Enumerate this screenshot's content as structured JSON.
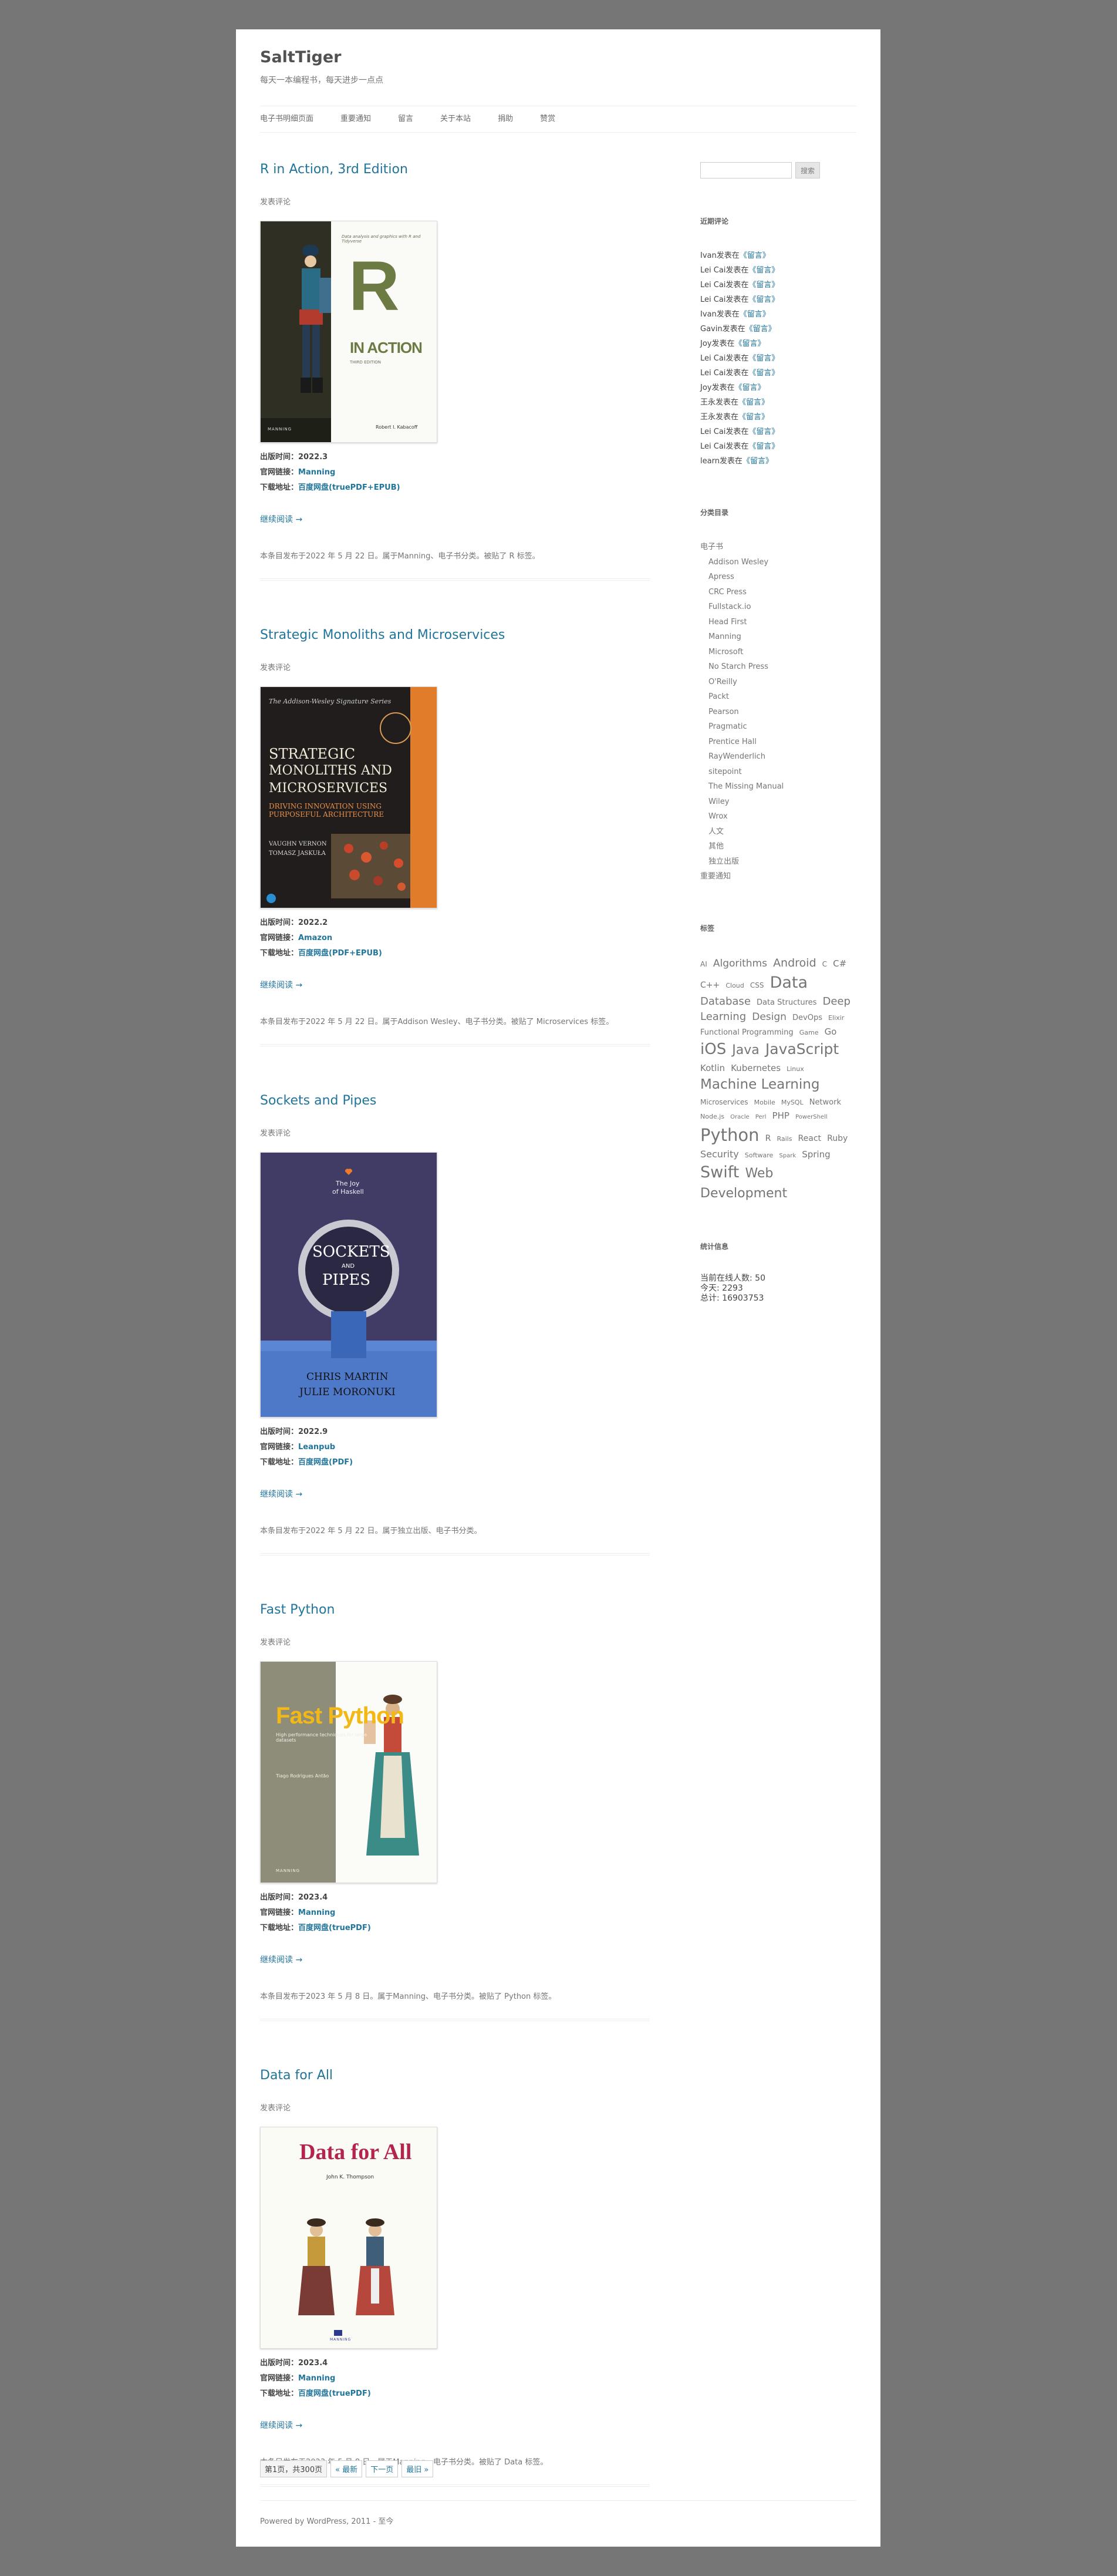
{
  "site": {
    "title": "SaltTiger",
    "description": "每天一本编程书，每天进步一点点"
  },
  "nav": [
    "电子书明细页面",
    "重要通知",
    "留言",
    "关于本站",
    "捐助",
    "赞赏"
  ],
  "posts": [
    {
      "title": "R in Action, 3rd Edition",
      "comments": "发表评论",
      "pub_label": "出版时间：",
      "pub": "2022.3",
      "site_label": "官网链接：",
      "site": "Manning",
      "dl_label": "下载地址：",
      "dl": "百度网盘(truePDF+EPUB)",
      "more": "继续阅读 →",
      "footer": "本条目发布于2022 年 5 月 22 日。属于Manning、电子书分类。被贴了 R 标签。",
      "cover": {
        "top": "Data analysis and graphics with R and Tidyverse",
        "letter": "R",
        "sub": "IN ACTION",
        "ed": "THIRD EDITION",
        "author": "Robert I. Kabacoff",
        "pub": "MANNING"
      }
    },
    {
      "title": "Strategic Monoliths and Microservices",
      "comments": "发表评论",
      "pub_label": "出版时间：",
      "pub": "2022.2",
      "site_label": "官网链接：",
      "site": "Amazon",
      "dl_label": "下载地址：",
      "dl": "百度网盘(PDF+EPUB)",
      "more": "继续阅读 →",
      "footer": "本条目发布于2022 年 5 月 22 日。属于Addison Wesley、电子书分类。被贴了 Microservices 标签。",
      "cover": {
        "top": "The Addison-Wesley Signature Series",
        "t1": "STRATEGIC",
        "t2": "MONOLITHS AND",
        "t3": "MICROSERVICES",
        "sub": "DRIVING INNOVATION USING PURPOSEFUL ARCHITECTURE",
        "a1": "VAUGHN VERNON",
        "a2": "TOMASZ JASKUŁA"
      }
    },
    {
      "title": "Sockets and Pipes",
      "comments": "发表评论",
      "pub_label": "出版时间：",
      "pub": "2022.9",
      "site_label": "官网链接：",
      "site": "Leanpub",
      "dl_label": "下载地址：",
      "dl": "百度网盘(PDF)",
      "more": "继续阅读 →",
      "footer": "本条目发布于2022 年 5 月 22 日。属于独立出版、电子书分类。",
      "cover": {
        "top1": "The Joy",
        "top2": "of Haskell",
        "t1": "SOCKETS",
        "t2": "AND",
        "t3": "PIPES",
        "a1": "CHRIS MARTIN",
        "a2": "JULIE MORONUKI"
      }
    },
    {
      "title": "Fast Python",
      "comments": "发表评论",
      "pub_label": "出版时间：",
      "pub": "2023.4",
      "site_label": "官网链接：",
      "site": "Manning",
      "dl_label": "下载地址：",
      "dl": "百度网盘(truePDF)",
      "more": "继续阅读 →",
      "footer": "本条目发布于2023 年 5 月 8 日。属于Manning、电子书分类。被贴了 Python 标签。",
      "cover": {
        "title": "Fast Python",
        "sub": "High performance techniques for large datasets",
        "author": "Tiago Rodrigues Antão",
        "pub": "MANNING"
      }
    },
    {
      "title": "Data for All",
      "comments": "发表评论",
      "pub_label": "出版时间：",
      "pub": "2023.4",
      "site_label": "官网链接：",
      "site": "Manning",
      "dl_label": "下载地址：",
      "dl": "百度网盘(truePDF)",
      "more": "继续阅读 →",
      "footer": "本条目发布于2023 年 5 月 8 日。属于Manning、电子书分类。被贴了 Data 标签。",
      "cover": {
        "title": "Data for All",
        "author": "John K. Thompson",
        "pub": "MANNING"
      }
    }
  ],
  "pagination": [
    "第1页，共300页",
    "« 最新",
    "下一页",
    "最旧 »"
  ],
  "footer": "Powered by WordPress, 2011 - 至今",
  "sidebar": {
    "search_button": "搜索",
    "recent_title": "近期评论",
    "recent_comments": [
      {
        "who": "Ivan发表在",
        "post": "《留言》"
      },
      {
        "who": "Lei Cai发表在",
        "post": "《留言》"
      },
      {
        "who": "Lei Cai发表在",
        "post": "《留言》"
      },
      {
        "who": "Lei Cai发表在",
        "post": "《留言》"
      },
      {
        "who": "Ivan发表在",
        "post": "《留言》"
      },
      {
        "who": "Gavin发表在",
        "post": "《留言》"
      },
      {
        "who": "Joy发表在",
        "post": "《留言》"
      },
      {
        "who": "Lei Cai发表在",
        "post": "《留言》"
      },
      {
        "who": "Lei Cai发表在",
        "post": "《留言》"
      },
      {
        "who": "Joy发表在",
        "post": "《留言》"
      },
      {
        "who": "王永发表在",
        "post": "《留言》"
      },
      {
        "who": "王永发表在",
        "post": "《留言》"
      },
      {
        "who": "Lei Cai发表在",
        "post": "《留言》"
      },
      {
        "who": "Lei Cai发表在",
        "post": "《留言》"
      },
      {
        "who": "learn发表在",
        "post": "《留言》"
      }
    ],
    "cat_title": "分类目录",
    "categories_top": "电子书",
    "categories": [
      "Addison Wesley",
      "Apress",
      "CRC Press",
      "Fullstack.io",
      "Head First",
      "Manning",
      "Microsoft",
      "No Starch Press",
      "O'Reilly",
      "Packt",
      "Pearson",
      "Pragmatic",
      "Prentice Hall",
      "RayWenderlich",
      "sitepoint",
      "The Missing Manual",
      "Wiley",
      "Wrox",
      "人文",
      "其他",
      "独立出版"
    ],
    "categories_last": "重要通知",
    "tag_title": "标签",
    "tags": [
      {
        "t": "AI",
        "s": 12
      },
      {
        "t": "Algorithms",
        "s": 17
      },
      {
        "t": "Android",
        "s": 19
      },
      {
        "t": "C",
        "s": 12
      },
      {
        "t": "C#",
        "s": 15
      },
      {
        "t": "C++",
        "s": 14
      },
      {
        "t": "Cloud",
        "s": 11
      },
      {
        "t": "CSS",
        "s": 12
      },
      {
        "t": "Data",
        "s": 27
      },
      {
        "t": "Database",
        "s": 18
      },
      {
        "t": "Data Structures",
        "s": 13
      },
      {
        "t": "Deep Learning",
        "s": 18
      },
      {
        "t": "Design",
        "s": 17
      },
      {
        "t": "DevOps",
        "s": 13
      },
      {
        "t": "Elixir",
        "s": 11
      },
      {
        "t": "Functional Programming",
        "s": 13
      },
      {
        "t": "Game",
        "s": 11
      },
      {
        "t": "Go",
        "s": 15
      },
      {
        "t": "iOS",
        "s": 26
      },
      {
        "t": "Java",
        "s": 22
      },
      {
        "t": "JavaScript",
        "s": 25
      },
      {
        "t": "Kotlin",
        "s": 15
      },
      {
        "t": "Kubernetes",
        "s": 15
      },
      {
        "t": "Linux",
        "s": 11
      },
      {
        "t": "Machine Learning",
        "s": 23
      },
      {
        "t": "Microservices",
        "s": 12
      },
      {
        "t": "Mobile",
        "s": 11
      },
      {
        "t": "MySQL",
        "s": 11
      },
      {
        "t": "Network",
        "s": 13
      },
      {
        "t": "Node.js",
        "s": 11
      },
      {
        "t": "Oracle",
        "s": 10
      },
      {
        "t": "Perl",
        "s": 10
      },
      {
        "t": "PHP",
        "s": 15
      },
      {
        "t": "PowerShell",
        "s": 10
      },
      {
        "t": "Python",
        "s": 29
      },
      {
        "t": "R",
        "s": 14
      },
      {
        "t": "Rails",
        "s": 11
      },
      {
        "t": "React",
        "s": 14
      },
      {
        "t": "Ruby",
        "s": 14
      },
      {
        "t": "Security",
        "s": 16
      },
      {
        "t": "Software",
        "s": 11
      },
      {
        "t": "Spark",
        "s": 10
      },
      {
        "t": "Spring",
        "s": 15
      },
      {
        "t": "Swift",
        "s": 27
      },
      {
        "t": "Web Development",
        "s": 22
      }
    ],
    "stats_title": "统计信息",
    "stats": [
      "当前在线人数: 50",
      "今天: 2293",
      "总计: 16903753"
    ]
  },
  "colors": {
    "link": "#21759b",
    "page_bg": "#767676"
  }
}
